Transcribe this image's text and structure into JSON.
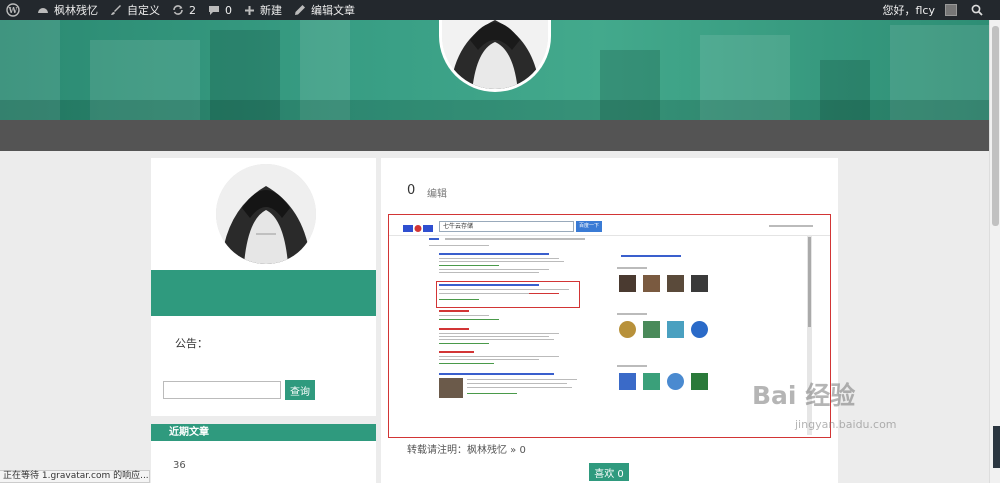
{
  "admin_bar": {
    "site_name": "枫林残忆",
    "customize": "自定义",
    "comments_count": "2",
    "pending_count": "0",
    "new_label": "新建",
    "edit_label": "编辑文章",
    "greeting": "您好，flcy"
  },
  "sidebar": {
    "notice_label": "公告：",
    "search_placeholder": "",
    "search_button": "查询",
    "recent_heading": "近期文章",
    "recent_count": "36"
  },
  "post": {
    "likes_count": "0",
    "edit_link": "编辑",
    "repost_note": "转载请注明：枫林残忆 » 0",
    "like_button": "喜欢 0"
  },
  "embedded_screenshot": {
    "search_query": "七牛云存储",
    "search_button": "百度一下"
  },
  "status_bar": {
    "text": "正在等待 1.gravatar.com 的响应..."
  },
  "watermark": {
    "line1": "Bai 经验",
    "line2": "jingyan.baidu.com"
  },
  "colors": {
    "accent": "#2f9a7e",
    "admin_bar": "#23282d",
    "highlight_border": "#d23535"
  }
}
